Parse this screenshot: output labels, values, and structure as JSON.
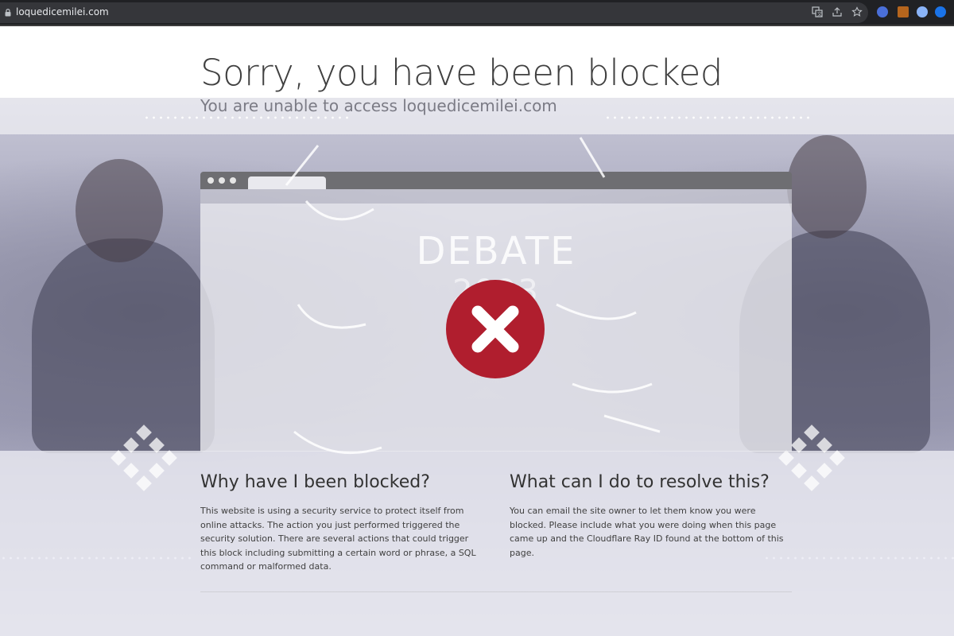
{
  "browser": {
    "url": "loquedicemilei.com",
    "icons": [
      "lock-icon",
      "translate-icon",
      "share-icon",
      "bookmark-star-icon"
    ],
    "extensions": [
      {
        "name": "extension-cursor-icon",
        "color": "#4a6fd8"
      },
      {
        "name": "extension-clipboard-icon",
        "color": "#b5651d"
      },
      {
        "name": "extension-globe-icon",
        "color": "#8ab4f8"
      },
      {
        "name": "extension-e-icon",
        "color": "#1a73e8"
      }
    ]
  },
  "page": {
    "title": "Sorry, you have been blocked",
    "subtitle": "You are unable to access loquedicemilei.com"
  },
  "illustration": {
    "banner_word": "DEBATE",
    "banner_year": "2023",
    "status_icon": "error-x-icon",
    "status_color": "#b01e2e"
  },
  "why": {
    "heading": "Why have I been blocked?",
    "body": "This website is using a security service to protect itself from online attacks. The action you just performed triggered the security solution. There are several actions that could trigger this block including submitting a certain word or phrase, a SQL command or malformed data."
  },
  "resolve": {
    "heading": "What can I do to resolve this?",
    "body": "You can email the site owner to let them know you were blocked. Please include what you were doing when this page came up and the Cloudflare Ray ID found at the bottom of this page."
  }
}
